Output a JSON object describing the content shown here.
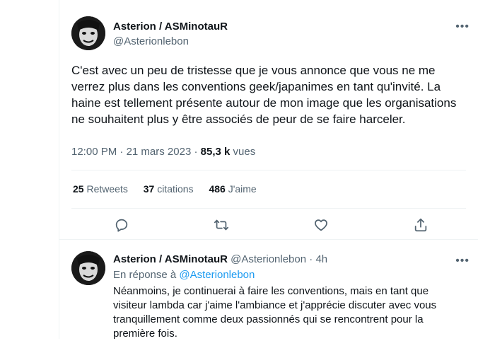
{
  "main_tweet": {
    "author_name": "Asterion / ASMinotauR",
    "author_handle": "@Asterionlebon",
    "more_icon": "more-dots-icon",
    "text": "C'est avec un peu de tristesse que je vous annonce que vous ne me verrez plus dans les conventions geek/japanimes en tant qu'invité. La haine est tellement présente autour de mon image que les organisations ne souhaitent plus y être associés de peur de se faire harceler.",
    "time": "12:00 PM",
    "date": "21 mars 2023",
    "views_count": "85,3 k",
    "views_label": "vues",
    "retweets_count": "25",
    "retweets_label": "Retweets",
    "quotes_count": "37",
    "quotes_label": "citations",
    "likes_count": "486",
    "likes_label": "J'aime",
    "actions": [
      "reply-icon",
      "retweet-icon",
      "like-icon",
      "share-icon"
    ]
  },
  "reply_tweet": {
    "author_name": "Asterion / ASMinotauR",
    "author_handle": "@Asterionlebon",
    "time_ago": "4h",
    "in_reply_prefix": "En réponse à",
    "in_reply_handle": "@Asterionlebon",
    "text": "Néanmoins, je continuerai à faire les conventions, mais en tant que visiteur lambda car j'aime l'ambiance et j'apprécie discuter avec vous tranquillement comme deux passionnés qui se rencontrent pour la première fois."
  },
  "colors": {
    "text_primary": "#0f1419",
    "text_secondary": "#536471",
    "link": "#1d9bf0",
    "border": "#eff3f4"
  }
}
